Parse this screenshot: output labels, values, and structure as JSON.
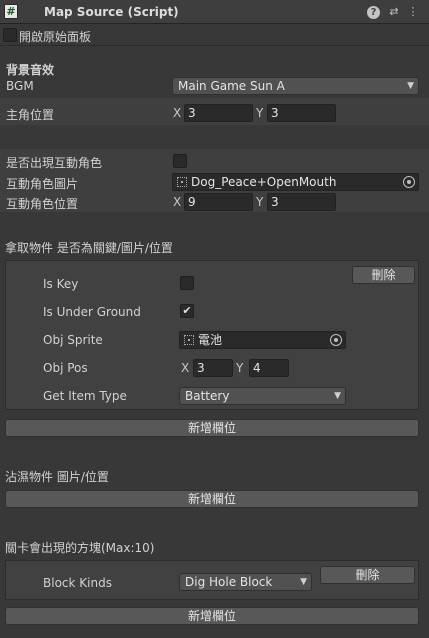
{
  "header": {
    "title": "Map Source (Script)",
    "script_icon": "#",
    "help_icon": "?",
    "settings_icon": "⇄",
    "menu_icon": "⋮"
  },
  "open_original_panel": {
    "label": "開啟原始面板",
    "checked": false
  },
  "bgm_section": {
    "heading": "背景音效",
    "bgm_label": "BGM",
    "bgm_value": "Main Game Sun A"
  },
  "protagonist": {
    "label": "主角位置",
    "x_label": "X",
    "x": "3",
    "y_label": "Y",
    "y": "3"
  },
  "interactive_role": {
    "show_label": "是否出現互動角色",
    "show_checked": false,
    "image_label": "互動角色圖片",
    "image_value": "Dog_Peace+OpenMouth",
    "pos_label": "互動角色位置",
    "x_label": "X",
    "x": "9",
    "y_label": "Y",
    "y": "3"
  },
  "pickup_items": {
    "heading": "拿取物件 是否為關鍵/圖片/位置",
    "remove_label": "刪除",
    "is_key_label": "Is Key",
    "is_key": false,
    "is_under_ground_label": "Is Under Ground",
    "is_under_ground": true,
    "obj_sprite_label": "Obj Sprite",
    "obj_sprite_value": "電池",
    "obj_pos_label": "Obj Pos",
    "x_label": "X",
    "x": "3",
    "y_label": "Y",
    "y": "4",
    "get_item_type_label": "Get Item Type",
    "get_item_type_value": "Battery",
    "add_label": "新增欄位"
  },
  "wet_items": {
    "heading": "沾濕物件 圖片/位置",
    "add_label": "新增欄位"
  },
  "blocks": {
    "heading": "關卡會出現的方塊(Max:10)",
    "block_kinds_label": "Block Kinds",
    "block_kinds_value": "Dig Hole Block",
    "remove_label": "刪除",
    "add_label": "新增欄位"
  },
  "check_mark": "✔",
  "dropdown_arrow": "▼"
}
